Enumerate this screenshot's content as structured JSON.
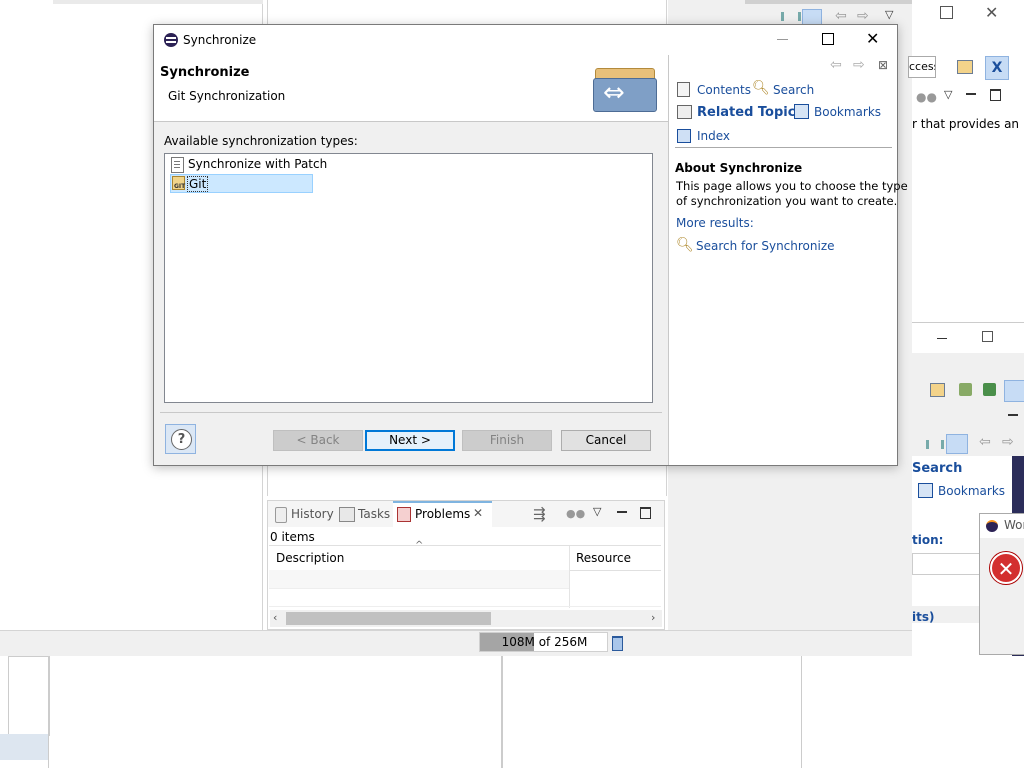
{
  "background": {
    "search_label": "Search",
    "bookmarks_label": "Bookmarks",
    "field_fragment": "ccess",
    "text_fragment": "r that provides an",
    "tion_fragment": "tion:",
    "its_fragment": "its)",
    "error_window_title_fragment": "Wor"
  },
  "dialog": {
    "title": "Synchronize",
    "heading": "Synchronize",
    "subheading": "Git Synchronization",
    "list_label": "Available synchronization types:",
    "items": [
      {
        "label": "Synchronize with Patch",
        "icon": "patch-file-icon"
      },
      {
        "label": "Git",
        "icon": "git-repo-icon",
        "selected": true
      }
    ],
    "buttons": {
      "help": "?",
      "back": "< Back",
      "next": "Next >",
      "finish": "Finish",
      "cancel": "Cancel"
    }
  },
  "help_panel": {
    "contents": "Contents",
    "search": "Search",
    "related_topics": "Related Topics",
    "bookmarks": "Bookmarks",
    "index": "Index",
    "about_title": "About Synchronize",
    "about_text_line1": "This page allows you to choose the type",
    "about_text_line2": "of synchronization you want to create.",
    "more_results": "More results:",
    "search_for": "Search for Synchronize"
  },
  "problems_view": {
    "tabs": [
      "History",
      "Tasks",
      "Problems"
    ],
    "count": "0 items",
    "columns": [
      "Description",
      "Resource"
    ]
  },
  "status_bar": {
    "heap": "108M of 256M"
  },
  "colors": {
    "selection": "#cce8ff",
    "link_blue": "#1a4e9c",
    "error_red": "#d32f2f"
  }
}
